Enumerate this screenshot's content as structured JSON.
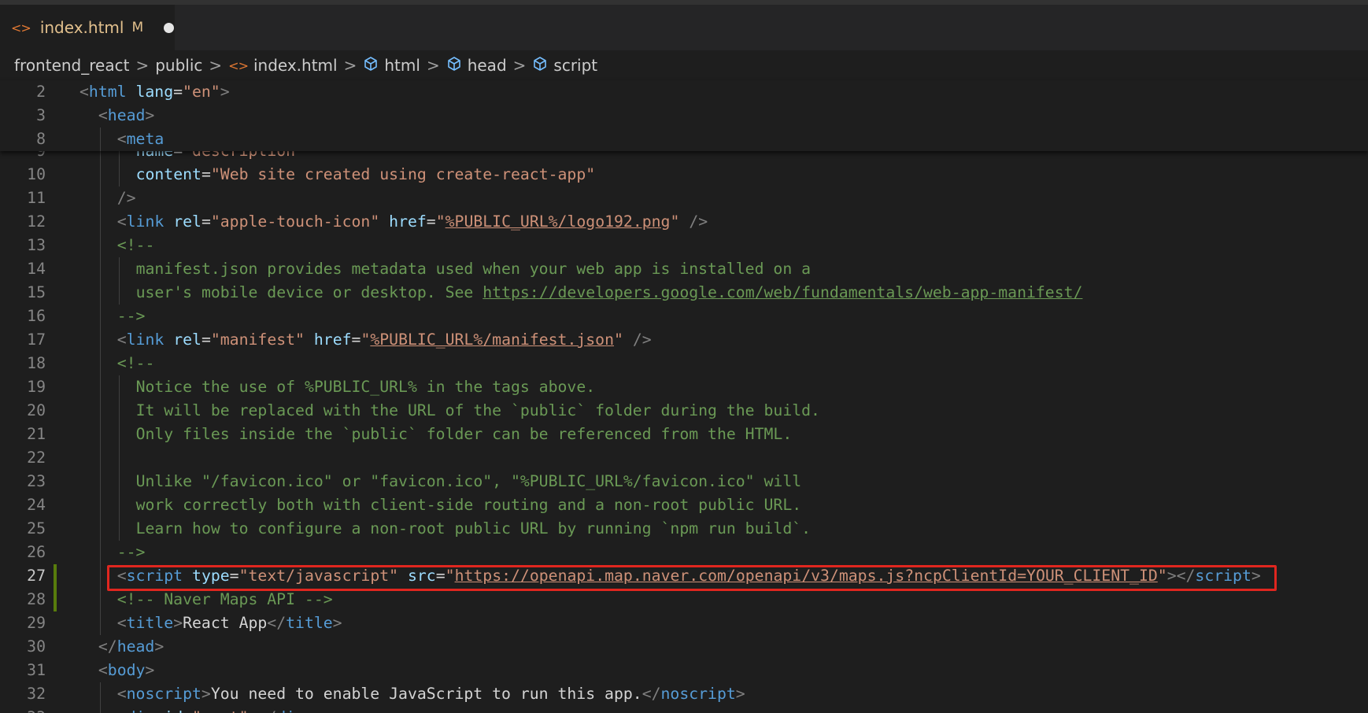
{
  "tab": {
    "icon": "html-file-icon",
    "filename": "index.html",
    "badge": "M"
  },
  "breadcrumb": [
    "frontend_react",
    "public",
    "index.html",
    "html",
    "head",
    "script"
  ],
  "colors": {
    "tag": "#569cd6",
    "attr": "#9cdcfe",
    "value": "#ce9178",
    "comment": "#6a9955",
    "highlight": "#e0261f",
    "modified": "#587c0c"
  },
  "sticky_lines": [
    {
      "n": "2",
      "indent": 1,
      "tokens": [
        [
          "t",
          "<"
        ],
        [
          "tn",
          "html"
        ],
        [
          "tx",
          " "
        ],
        [
          "an",
          "lang"
        ],
        [
          "tx",
          "="
        ],
        [
          "av",
          "\"en\""
        ],
        [
          "t",
          ">"
        ]
      ]
    },
    {
      "n": "3",
      "indent": 2,
      "tokens": [
        [
          "t",
          "<"
        ],
        [
          "tn",
          "head"
        ],
        [
          "t",
          ">"
        ]
      ]
    },
    {
      "n": "8",
      "indent": 3,
      "tokens": [
        [
          "t",
          "<"
        ],
        [
          "tn",
          "meta"
        ]
      ]
    }
  ],
  "lines": [
    {
      "n": "9",
      "indent": 4,
      "tokens": [
        [
          "an",
          "name"
        ],
        [
          "tx",
          "="
        ],
        [
          "av",
          "\"description\""
        ]
      ]
    },
    {
      "n": "10",
      "indent": 4,
      "tokens": [
        [
          "an",
          "content"
        ],
        [
          "tx",
          "="
        ],
        [
          "av",
          "\"Web site created using create-react-app\""
        ]
      ]
    },
    {
      "n": "11",
      "indent": 3,
      "tokens": [
        [
          "t",
          "/>"
        ]
      ]
    },
    {
      "n": "12",
      "indent": 3,
      "tokens": [
        [
          "t",
          "<"
        ],
        [
          "tn",
          "link"
        ],
        [
          "tx",
          " "
        ],
        [
          "an",
          "rel"
        ],
        [
          "tx",
          "="
        ],
        [
          "av",
          "\"apple-touch-icon\""
        ],
        [
          "tx",
          " "
        ],
        [
          "an",
          "href"
        ],
        [
          "tx",
          "="
        ],
        [
          "av",
          "\""
        ],
        [
          "avl",
          "%PUBLIC_URL%/logo192.png"
        ],
        [
          "av",
          "\""
        ],
        [
          "tx",
          " "
        ],
        [
          "t",
          "/>"
        ]
      ]
    },
    {
      "n": "13",
      "indent": 3,
      "tokens": [
        [
          "cm",
          "<!--"
        ]
      ]
    },
    {
      "n": "14",
      "indent": 4,
      "tokens": [
        [
          "cm",
          "manifest.json provides metadata used when your web app is installed on a"
        ]
      ]
    },
    {
      "n": "15",
      "indent": 4,
      "tokens": [
        [
          "cm",
          "user's mobile device or desktop. See "
        ],
        [
          "cml",
          "https://developers.google.com/web/fundamentals/web-app-manifest/"
        ]
      ]
    },
    {
      "n": "16",
      "indent": 3,
      "tokens": [
        [
          "cm",
          "-->"
        ]
      ]
    },
    {
      "n": "17",
      "indent": 3,
      "tokens": [
        [
          "t",
          "<"
        ],
        [
          "tn",
          "link"
        ],
        [
          "tx",
          " "
        ],
        [
          "an",
          "rel"
        ],
        [
          "tx",
          "="
        ],
        [
          "av",
          "\"manifest\""
        ],
        [
          "tx",
          " "
        ],
        [
          "an",
          "href"
        ],
        [
          "tx",
          "="
        ],
        [
          "av",
          "\""
        ],
        [
          "avl",
          "%PUBLIC_URL%/manifest.json"
        ],
        [
          "av",
          "\""
        ],
        [
          "tx",
          " "
        ],
        [
          "t",
          "/>"
        ]
      ]
    },
    {
      "n": "18",
      "indent": 3,
      "tokens": [
        [
          "cm",
          "<!--"
        ]
      ]
    },
    {
      "n": "19",
      "indent": 4,
      "tokens": [
        [
          "cm",
          "Notice the use of %PUBLIC_URL% in the tags above."
        ]
      ]
    },
    {
      "n": "20",
      "indent": 4,
      "tokens": [
        [
          "cm",
          "It will be replaced with the URL of the `public` folder during the build."
        ]
      ]
    },
    {
      "n": "21",
      "indent": 4,
      "tokens": [
        [
          "cm",
          "Only files inside the `public` folder can be referenced from the HTML."
        ]
      ]
    },
    {
      "n": "22",
      "indent": 4,
      "tokens": []
    },
    {
      "n": "23",
      "indent": 4,
      "tokens": [
        [
          "cm",
          "Unlike \"/favicon.ico\" or \"favicon.ico\", \"%PUBLIC_URL%/favicon.ico\" will"
        ]
      ]
    },
    {
      "n": "24",
      "indent": 4,
      "tokens": [
        [
          "cm",
          "work correctly both with client-side routing and a non-root public URL."
        ]
      ]
    },
    {
      "n": "25",
      "indent": 4,
      "tokens": [
        [
          "cm",
          "Learn how to configure a non-root public URL by running `npm run build`."
        ]
      ]
    },
    {
      "n": "26",
      "indent": 3,
      "tokens": [
        [
          "cm",
          "-->"
        ]
      ]
    },
    {
      "n": "27",
      "indent": 3,
      "active": true,
      "modified": true,
      "tokens": [
        [
          "t",
          "<"
        ],
        [
          "tn",
          "script"
        ],
        [
          "tx",
          " "
        ],
        [
          "an",
          "type"
        ],
        [
          "tx",
          "="
        ],
        [
          "av",
          "\"text/javascript\""
        ],
        [
          "tx",
          " "
        ],
        [
          "an",
          "src"
        ],
        [
          "tx",
          "="
        ],
        [
          "av",
          "\""
        ],
        [
          "avl",
          "https://openapi.map.naver.com/openapi/v3/maps.js?ncpClientId=YOUR_CLIENT_ID"
        ],
        [
          "av",
          "\""
        ],
        [
          "t",
          "></"
        ],
        [
          "tn",
          "script"
        ],
        [
          "t",
          ">"
        ]
      ]
    },
    {
      "n": "28",
      "indent": 3,
      "modified": true,
      "tokens": [
        [
          "cm",
          "<!-- Naver Maps API -->"
        ]
      ]
    },
    {
      "n": "29",
      "indent": 3,
      "tokens": [
        [
          "t",
          "<"
        ],
        [
          "tn",
          "title"
        ],
        [
          "t",
          ">"
        ],
        [
          "tx",
          "React App"
        ],
        [
          "t",
          "</"
        ],
        [
          "tn",
          "title"
        ],
        [
          "t",
          ">"
        ]
      ]
    },
    {
      "n": "30",
      "indent": 2,
      "tokens": [
        [
          "t",
          "</"
        ],
        [
          "tn",
          "head"
        ],
        [
          "t",
          ">"
        ]
      ]
    },
    {
      "n": "31",
      "indent": 2,
      "tokens": [
        [
          "t",
          "<"
        ],
        [
          "tn",
          "body"
        ],
        [
          "t",
          ">"
        ]
      ]
    },
    {
      "n": "32",
      "indent": 3,
      "tokens": [
        [
          "t",
          "<"
        ],
        [
          "tn",
          "noscript"
        ],
        [
          "t",
          ">"
        ],
        [
          "tx",
          "You need to enable JavaScript to run this app."
        ],
        [
          "t",
          "</"
        ],
        [
          "tn",
          "noscript"
        ],
        [
          "t",
          ">"
        ]
      ]
    },
    {
      "n": "33",
      "indent": 3,
      "tokens": [
        [
          "t",
          "<"
        ],
        [
          "tn",
          "div"
        ],
        [
          "tx",
          " "
        ],
        [
          "an",
          "id"
        ],
        [
          "tx",
          "="
        ],
        [
          "av",
          "\"root\""
        ],
        [
          "t",
          "></"
        ],
        [
          "tn",
          "div"
        ],
        [
          "t",
          ">"
        ]
      ]
    }
  ]
}
